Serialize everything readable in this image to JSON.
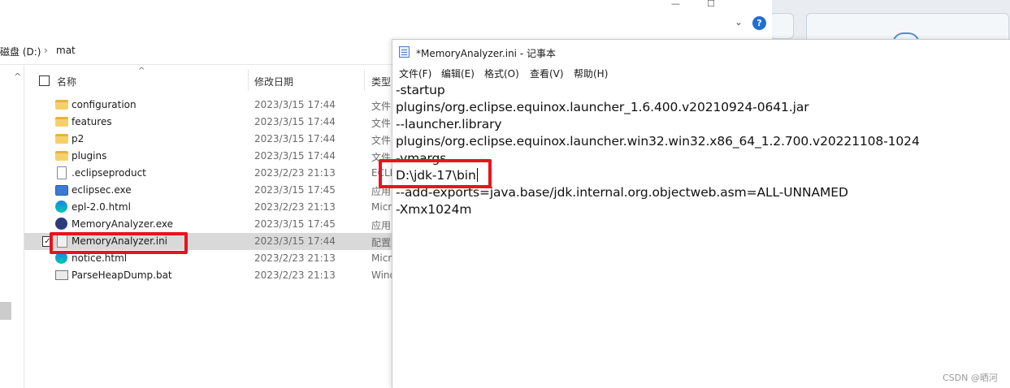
{
  "explorer": {
    "window_controls": [
      "—",
      "☐"
    ],
    "address": {
      "drive": "磁盘 (D:)",
      "separator": "›",
      "folder": "mat"
    },
    "columns": {
      "name": "名称",
      "date": "修改日期",
      "type": "类型"
    },
    "files": [
      {
        "name": "configuration",
        "date": "2023/3/15 17:44",
        "type": "文件",
        "icon": "folder-icon"
      },
      {
        "name": "features",
        "date": "2023/3/15 17:44",
        "type": "文件",
        "icon": "folder-icon"
      },
      {
        "name": "p2",
        "date": "2023/3/15 17:44",
        "type": "文件",
        "icon": "folder-icon"
      },
      {
        "name": "plugins",
        "date": "2023/3/15 17:44",
        "type": "文件",
        "icon": "folder-icon"
      },
      {
        "name": ".eclipseproduct",
        "date": "2023/2/23 21:13",
        "type": "ECLI",
        "icon": "document-icon"
      },
      {
        "name": "eclipsec.exe",
        "date": "2023/3/15 17:45",
        "type": "应用",
        "icon": "exe-icon"
      },
      {
        "name": "epl-2.0.html",
        "date": "2023/2/23 21:13",
        "type": "Micr",
        "icon": "edge-icon"
      },
      {
        "name": "MemoryAnalyzer.exe",
        "date": "2023/3/15 17:45",
        "type": "应用",
        "icon": "mat-icon"
      },
      {
        "name": "MemoryAnalyzer.ini",
        "date": "2023/3/15 17:44",
        "type": "配置",
        "icon": "ini-icon",
        "selected": true
      },
      {
        "name": "notice.html",
        "date": "2023/2/23 21:13",
        "type": "Micr",
        "icon": "edge-icon"
      },
      {
        "name": "ParseHeapDump.bat",
        "date": "2023/2/23 21:13",
        "type": "Wind",
        "icon": "bat-icon"
      }
    ]
  },
  "notepad": {
    "title": "*MemoryAnalyzer.ini - 记事本",
    "menu": [
      "文件(F)",
      "编辑(E)",
      "格式(O)",
      "查看(V)",
      "帮助(H)"
    ],
    "lines": [
      "-startup",
      "plugins/org.eclipse.equinox.launcher_1.6.400.v20210924-0641.jar",
      "--launcher.library",
      "plugins/org.eclipse.equinox.launcher.win32.win32.x86_64_1.2.700.v20221108-1024",
      "-vmargs",
      "D:\\jdk-17\\bin",
      "--add-exports=java.base/jdk.internal.org.objectweb.asm=ALL-UNNAMED",
      "-Xmx1024m"
    ]
  },
  "colors": {
    "highlight_box": "#e8141c",
    "selection": "#d9d9d9"
  },
  "watermark": "CSDN @晒河"
}
